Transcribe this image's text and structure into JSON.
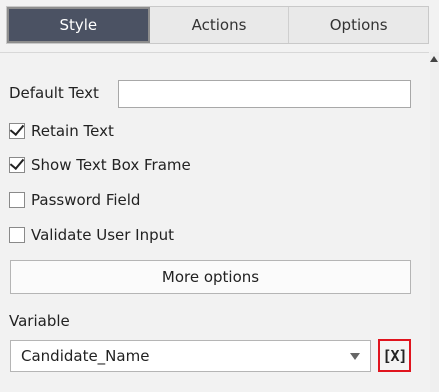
{
  "tabs": [
    {
      "label": "Style",
      "active": true
    },
    {
      "label": "Actions",
      "active": false
    },
    {
      "label": "Options",
      "active": false
    }
  ],
  "default_text": {
    "label": "Default Text",
    "value": ""
  },
  "checkboxes": [
    {
      "label": "Retain Text",
      "checked": true
    },
    {
      "label": "Show Text Box Frame",
      "checked": true
    },
    {
      "label": "Password Field",
      "checked": false
    },
    {
      "label": "Validate User Input",
      "checked": false
    }
  ],
  "more_options_label": "More options",
  "variable": {
    "label": "Variable",
    "selected": "Candidate_Name",
    "button_glyph": "[X]"
  },
  "colors": {
    "active_tab": "#4b5263",
    "highlight": "#e0141e"
  },
  "icons": {
    "dropdown": "chevron-down-icon",
    "variable_button": "insert-variable-icon",
    "scroll": "scroll-up-icon"
  }
}
